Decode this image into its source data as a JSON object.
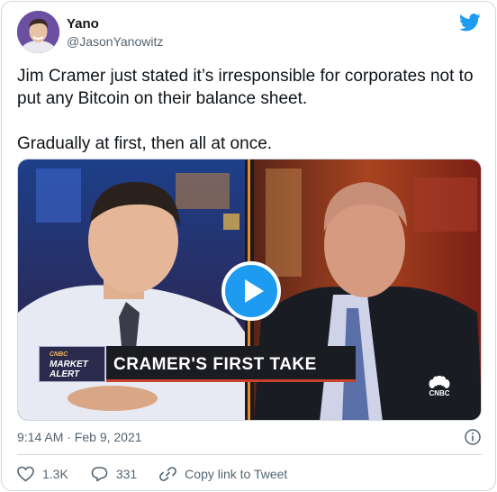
{
  "author": {
    "name": "Yano",
    "handle": "@JasonYanowitz"
  },
  "tweet": {
    "paragraphs": [
      "Jim Cramer just stated it’s irresponsible for corporates not to put any Bitcoin on their balance sheet.",
      "Gradually at first, then all at once."
    ]
  },
  "media": {
    "type": "video",
    "chyron_brand": "CNBC",
    "chyron_box_line1": "MARKET",
    "chyron_box_line2": "ALERT",
    "chyron_title": "CRAMER'S FIRST TAKE",
    "network_logo_text": "CNBC"
  },
  "meta": {
    "timestamp": "9:14 AM · Feb 9, 2021"
  },
  "actions": {
    "like_count": "1.3K",
    "reply_count": "331",
    "copy_link_label": "Copy link to Tweet"
  },
  "colors": {
    "accent": "#1d9bf0",
    "text_primary": "#0f1419",
    "text_secondary": "#536471",
    "border": "#cfd9de"
  },
  "icons": {
    "brand": "twitter-bird-icon",
    "play": "play-icon",
    "info": "info-icon",
    "like": "heart-icon",
    "reply": "speech-bubble-icon",
    "link": "link-icon"
  }
}
